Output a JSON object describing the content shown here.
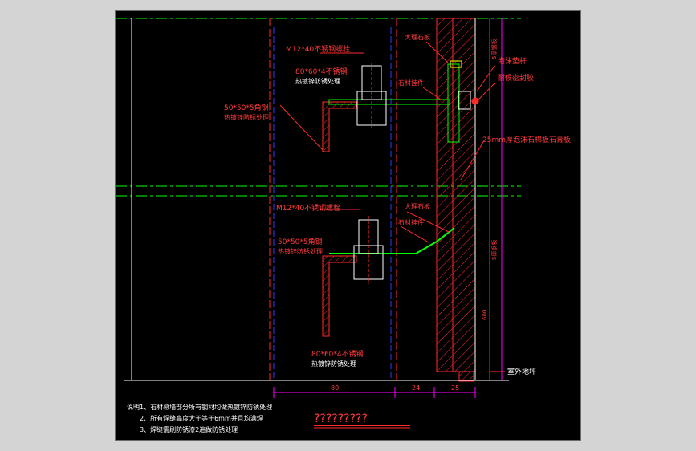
{
  "drawing": {
    "colors": {
      "background": "#000000",
      "frame": "#d4d4d4",
      "line_white": "#ffffff",
      "line_green": "#00ff00",
      "line_red": "#ff2a2a",
      "line_magenta": "#ff00ff",
      "line_blue": "#3a3aff",
      "line_yellow": "#ffff00",
      "label_red": "#ff3b3b",
      "label_white": "#ffffff"
    },
    "upper_detail": {
      "bolt_label": "M12*40不锈钢螺栓",
      "plate_label": "80*60*4不锈钢",
      "plate_label_2": "热镀锌防锈处理",
      "angle_label": "50*50*5角钢",
      "angle_label_2": "热镀锌防锈处理",
      "stone_label": "大理石板",
      "anchor_label": "石材挂件",
      "foam_label": "泡沫垫杆",
      "sealant_label": "耐候密封胶",
      "gap_label": "25mm厚泡沫石棉板石膏板",
      "dim_vertical": "5厚钢板"
    },
    "lower_detail": {
      "bolt_label": "M12*40不锈钢螺栓",
      "angle_label": "50*50*5角钢",
      "angle_label_2": "热镀锌防锈处理",
      "stone_label": "大理石板",
      "anchor_label": "石材挂件",
      "plate_label": "80*60*4不锈钢",
      "plate_label_2": "热镀锌防锈处理",
      "ground_label": "室外地坪",
      "dim_vertical": "5厚钢板",
      "dim_small": "600"
    },
    "dimensions": {
      "d1": "80",
      "d2": "24",
      "d3": "25"
    },
    "notes": {
      "line1": "说明1、石材幕墙部分所有钢材均做热镀锌防锈处理",
      "line2": "2、所有焊缝高度大于等于6mm并且均满焊",
      "line3": "3、焊缝需刷防锈漆2遍做防锈处理"
    },
    "title": "?????????"
  }
}
